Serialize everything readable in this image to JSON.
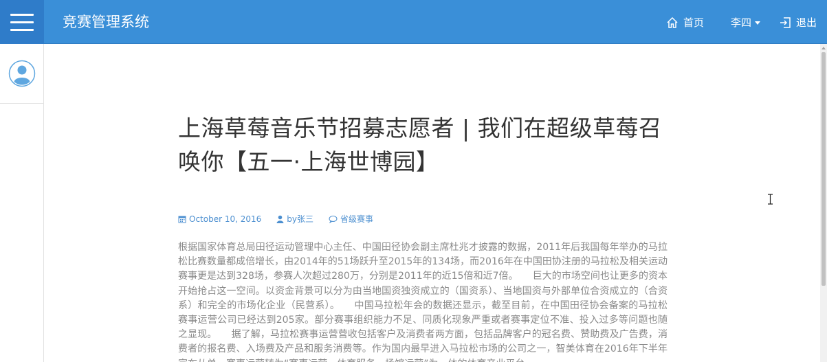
{
  "header": {
    "app_title": "竞赛管理系统",
    "nav": {
      "home_label": "首页",
      "user_label": "李四",
      "logout_label": "退出"
    }
  },
  "sidebar": {
    "avatar_icon": "user-avatar-icon"
  },
  "article": {
    "title": "上海草莓音乐节招募志愿者 | 我们在超级草莓召唤你【五一·上海世博园】",
    "date": "October 10, 2016",
    "author": "by张三",
    "category": "省级赛事",
    "body": "根据国家体育总局田径运动管理中心主任、中国田径协会副主席杜兆才披露的数据，2011年后我国每年举办的马拉松比赛数量都成倍增长，由2014年的51场跃升至2015年的134场，而2016年在中国田协注册的马拉松及相关运动赛事更是达到328场，参赛人次超过280万，分别是2011年的近15倍和近7倍。　　巨大的市场空间也让更多的资本开始抢占这一空间。以资金背景可以分为由当地国资独资成立的（国资系）、当地国资与外部单位合资成立的（合资系）和完全的市场化企业（民营系）。　　中国马拉松年会的数据还显示，截至目前，在中国田径协会备案的马拉松赛事运营公司已经达到205家。部分赛事组织能力不足、同质化现象严重或者赛事定位不准、投入过多等问题也随之显现。　　据了解，马拉松赛事运营营收包括客户及消费者两方面，包括品牌客户的冠名费、赞助费及广告费，消费者的报名费、入场费及产品和服务消费等。作为国内最早进入马拉松市场的公司之一，智美体育在2016年下半年宣布从单一赛事运营转为“赛事运营、体育服务、场馆运营”为一体的体育产业平台。"
  },
  "colors": {
    "header_bg": "#3a8fd8",
    "menu_btn_bg": "#2f7cc9",
    "meta_accent": "#4c8fd0",
    "title_text": "#333333",
    "body_text": "#8a8a8a"
  }
}
